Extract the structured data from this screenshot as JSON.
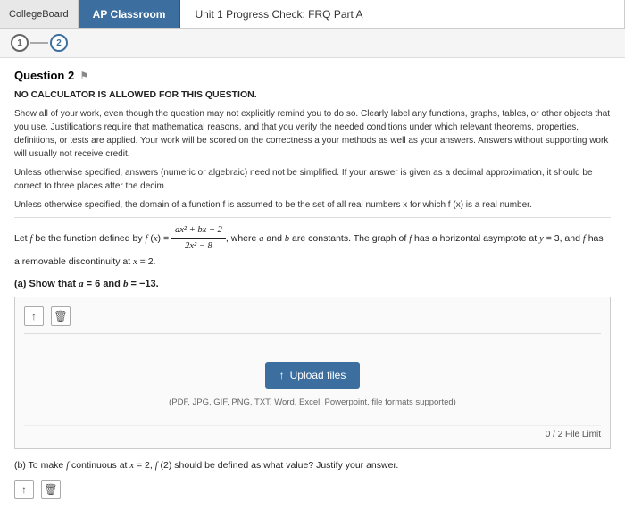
{
  "topbar": {
    "collegeboard_label": "CollegeBoard",
    "ap_tab": "AP Classroom",
    "page_title": "Unit 1 Progress Check: FRQ Part A"
  },
  "steps": {
    "step1": "1",
    "step2": "2"
  },
  "question": {
    "title": "Question 2",
    "no_calc": "NO CALCULATOR IS ALLOWED FOR THIS QUESTION.",
    "instructions_1": "Show all of your work, even though the question may not explicitly remind you to do so. Clearly label any functions, graphs, tables, or other objects that you use. Justifications require that mathematical reasons, and that you verify the needed conditions under which relevant theorems, properties, definitions, or tests are applied. Your work will be scored on the correctness a your methods as well as your answers. Answers without supporting work will usually not receive credit.",
    "instructions_2": "Unless otherwise specified, answers (numeric or algebraic) need not be simplified. If your answer is given as a decimal approximation, it should be correct to three places after the decim",
    "instructions_3": "Unless otherwise specified, the domain of a function f is assumed to be the set of all real numbers x for which f (x) is a real number.",
    "problem_text": "Let f be the function defined by f (x) = (ax² + bx + 2) / (2x² - 8), where a and b are constants. The graph of f has a horizontal asymptote at y = 3, and f has a removable discontinuity at x = 2.",
    "part_a_label": "(a) Show that a = 6 and b = −13.",
    "part_b_label": "(b) To make f continuous at x = 2, f (2) should be defined as what value? Justify your answer."
  },
  "upload": {
    "button_label": "Upload files",
    "formats_text": "(PDF, JPG, GIF, PNG, TXT, Word, Excel, Powerpoint, file formats supported)",
    "file_limit_text": "0 / 2 File Limit"
  },
  "toolbar": {
    "upload_icon": "↑",
    "trash_icon": "🗑"
  }
}
